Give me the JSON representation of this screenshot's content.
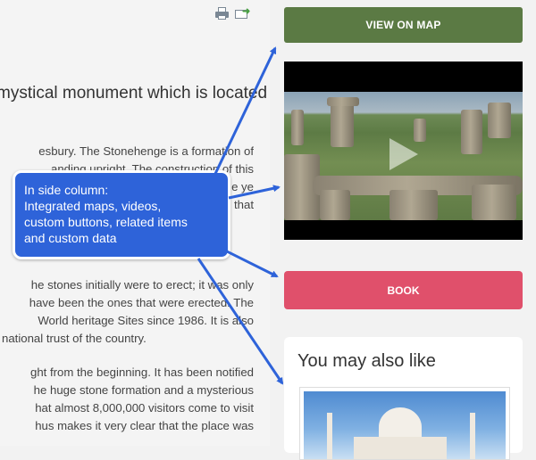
{
  "article": {
    "lead": "mystical monument which is located",
    "para1": [
      "esbury. The Stonehenge is a formation of",
      "anding upright. The construction of this",
      "e ye",
      "that"
    ],
    "para2": [
      "he stones initially were to erect; it was only",
      "have been the ones that were erected. The",
      "World heritage Sites since 1986. It is also",
      "national trust of the country."
    ],
    "para3": [
      "ght from the beginning. It has been notified",
      "he huge stone formation and a mysterious",
      "hat almost 8,000,000 visitors come to visit",
      "hus makes it very clear that the place was"
    ]
  },
  "toolbar": {
    "print_icon": "printer-icon",
    "email_icon": "email-icon"
  },
  "side": {
    "map_button": "VIEW ON MAP",
    "book_button": "BOOK",
    "related_title": "You may also like",
    "map_color": "#5b7a44",
    "book_color": "#e0506b"
  },
  "callout": {
    "lines": [
      "In side column:",
      "Integrated maps, videos,",
      "custom buttons, related items",
      "and custom data"
    ],
    "color": "#2e63d9"
  }
}
